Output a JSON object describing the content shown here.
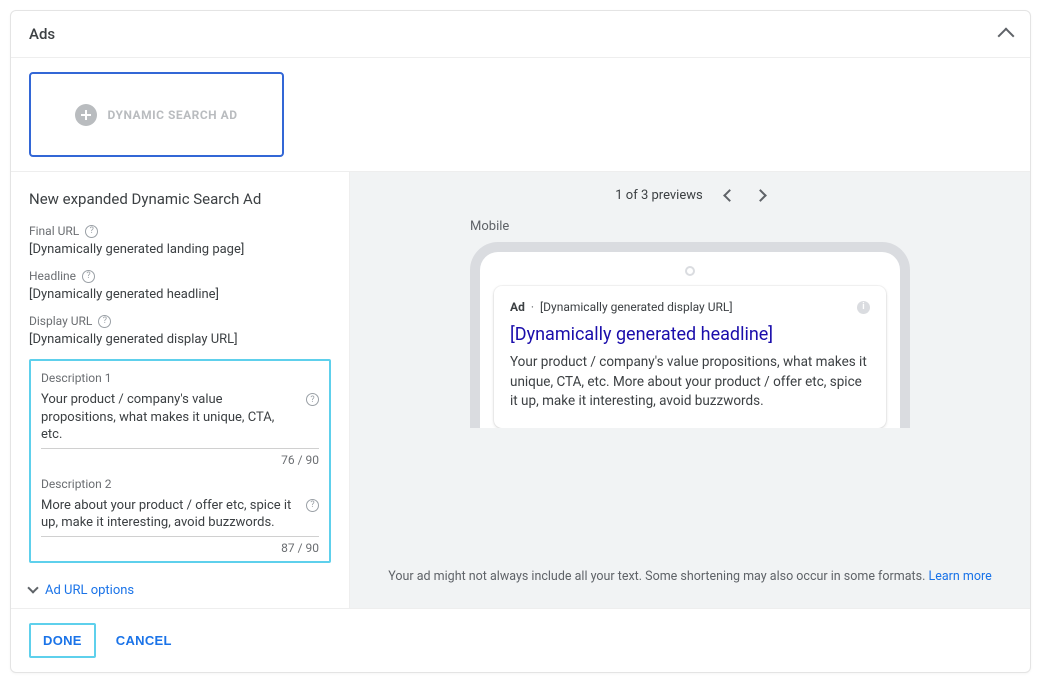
{
  "card_title": "Ads",
  "ad_type_label": "DYNAMIC SEARCH AD",
  "form": {
    "title": "New expanded Dynamic Search Ad",
    "final_url": {
      "label": "Final URL",
      "value": "[Dynamically generated landing page]"
    },
    "headline": {
      "label": "Headline",
      "value": "[Dynamically generated headline]"
    },
    "display_url": {
      "label": "Display URL",
      "value": "[Dynamically generated display URL]"
    },
    "desc1": {
      "label": "Description 1",
      "value": "Your product / company's value propositions, what makes it unique, CTA, etc.",
      "count": "76 / 90"
    },
    "desc2": {
      "label": "Description 2",
      "value": "More about your product / offer etc, spice it up, make it interesting, avoid buzzwords.",
      "count": "87 / 90"
    },
    "url_options": "Ad URL options"
  },
  "preview": {
    "pager": "1 of 3 previews",
    "device_label": "Mobile",
    "ad_badge": "Ad",
    "ad_display_url": "[Dynamically generated display URL]",
    "ad_headline": "[Dynamically generated headline]",
    "ad_description": "Your product / company's value propositions, what makes it unique, CTA, etc. More about your product / offer etc, spice it up, make it interesting, avoid buzzwords.",
    "note_text": "Your ad might not always include all your text. Some shortening may also occur in some formats. ",
    "note_link": "Learn more"
  },
  "buttons": {
    "done": "DONE",
    "cancel": "CANCEL"
  }
}
